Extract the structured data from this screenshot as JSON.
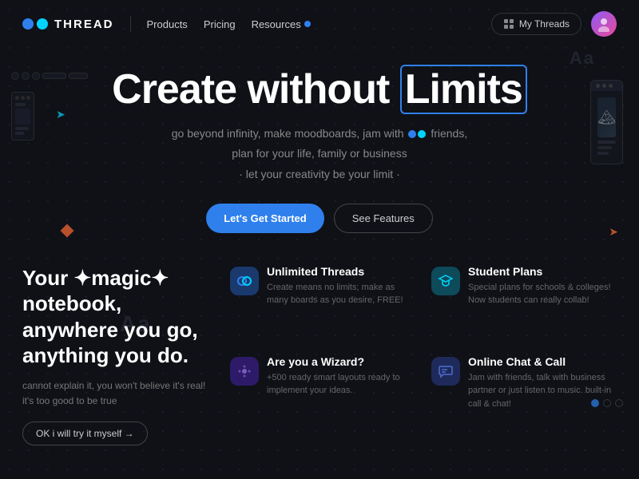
{
  "nav": {
    "logo_text": "THREAD",
    "links": [
      {
        "label": "Products",
        "has_badge": false
      },
      {
        "label": "Pricing",
        "has_badge": false
      },
      {
        "label": "Resources",
        "has_badge": true
      }
    ],
    "my_threads_label": "My Threads",
    "avatar_emoji": "👤"
  },
  "hero": {
    "title_start": "Create without ",
    "title_highlight": "Limits",
    "subtitle_line1": "go beyond infinity, make moodboards, jam with",
    "subtitle_line2": "friends,",
    "subtitle_line3": "plan for your life, family or business",
    "subtitle_line4": "· let your creativity be your limit ·",
    "cta_primary": "Let's Get Started",
    "cta_secondary": "See Features"
  },
  "bottom": {
    "magic_title_line1": "Your ✦magic✦ notebook,",
    "magic_title_line2": "anywhere you go,",
    "magic_title_line3": "anything you do.",
    "magic_subtitle": "cannot explain it, you won't believe it's real! it's too good to be true",
    "try_btn": "OK i will try it myself →"
  },
  "features": [
    {
      "icon": "🔵",
      "icon_class": "icon-blue",
      "title": "Unlimited Threads",
      "desc": "Create means no limits; make as many boards as you desire, FREE!"
    },
    {
      "icon": "🔷",
      "icon_class": "icon-teal",
      "title": "Student Plans",
      "desc": "Special plans for schools & colleges! Now students can really collab!"
    },
    {
      "icon": "✨",
      "icon_class": "icon-purple",
      "title": "Are you a Wizard?",
      "desc": "+500 ready smart layouts ready to implement your ideas."
    },
    {
      "icon": "💬",
      "icon_class": "icon-indigo",
      "title": "Online Chat & Call",
      "desc": "Jam with friends, talk with business partner or just listen to music. built-in call & chat!"
    }
  ],
  "decorative": {
    "aa_text": "Aa"
  }
}
